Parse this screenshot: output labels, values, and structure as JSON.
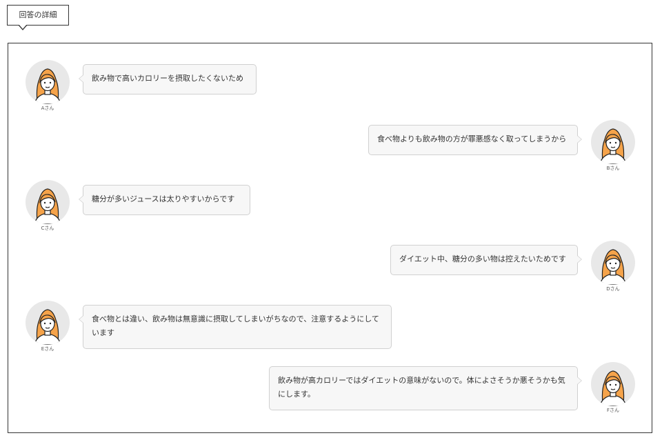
{
  "header": {
    "label": "回答の詳細"
  },
  "colors": {
    "hair": "#f5a34a",
    "skin": "#ffffff",
    "avatar_bg": "#e8e8e8",
    "bubble_bg": "#f7f7f7",
    "border": "#333333"
  },
  "responses": [
    {
      "name": "Aさん",
      "side": "left",
      "text": "飲み物で高いカロリーを摂取したくないため",
      "icon": "woman-avatar-icon"
    },
    {
      "name": "Bさん",
      "side": "right",
      "text": "食べ物よりも飲み物の方が罪悪感なく取ってしまうから",
      "icon": "woman-avatar-icon"
    },
    {
      "name": "Cさん",
      "side": "left",
      "text": "糖分が多いジュースは太りやすいからです",
      "icon": "woman-avatar-icon"
    },
    {
      "name": "Dさん",
      "side": "right",
      "text": "ダイエット中、糖分の多い物は控えたいためです",
      "icon": "woman-avatar-icon"
    },
    {
      "name": "Eさん",
      "side": "left",
      "text": "食べ物とは違い、飲み物は無意識に摂取してしまいがちなので、注意するようにしています",
      "icon": "woman-avatar-icon"
    },
    {
      "name": "Fさん",
      "side": "right",
      "text": "飲み物が高カロリーではダイエットの意味がないので。体によさそうか悪そうかも気にします。",
      "icon": "woman-avatar-icon"
    }
  ]
}
